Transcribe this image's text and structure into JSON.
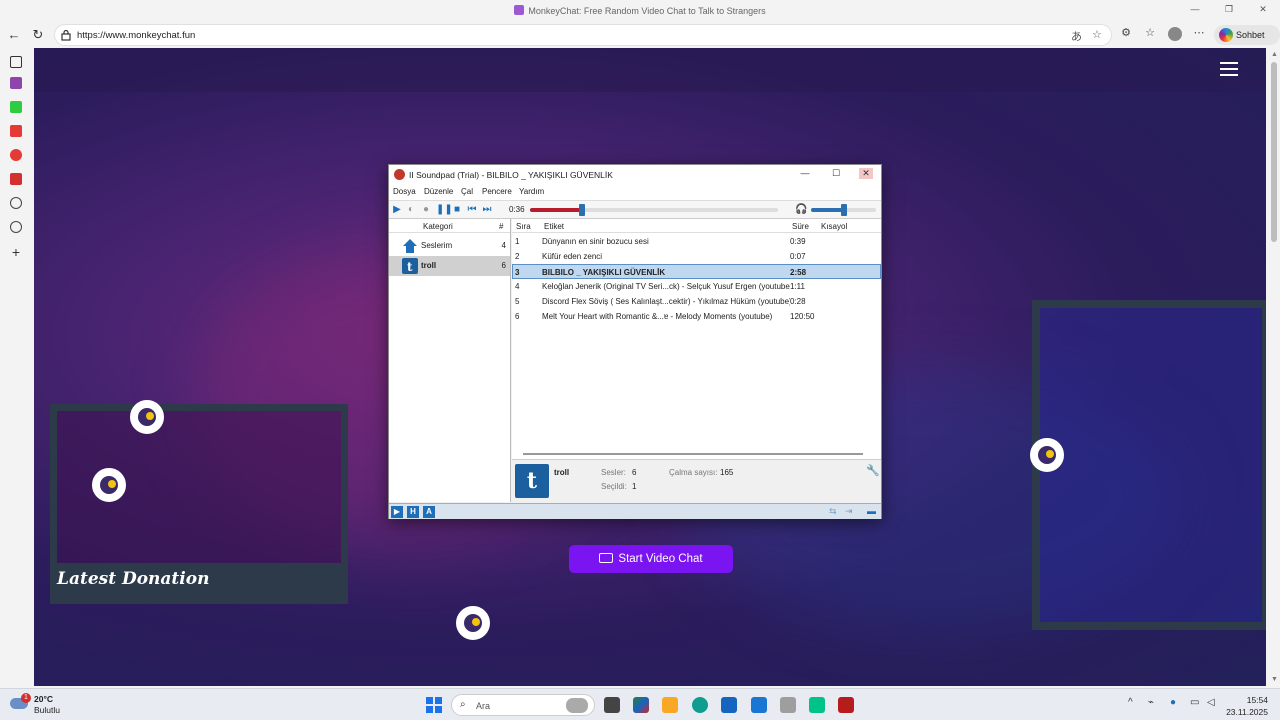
{
  "browser": {
    "window_title": "MonkeyChat: Free Random Video Chat to Talk to Strangers",
    "url": "https://www.monkeychat.fun",
    "copilot_label": "Sohbet et"
  },
  "page": {
    "latest_donation": "Latest Donation",
    "start_button": "Start Video Chat"
  },
  "soundpad": {
    "title": "II  Soundpad (Trial) - BILBILO _ YAKIŞIKLI GÜVENLİK",
    "menu": [
      "Dosya",
      "Düzenle",
      "Çal",
      "Pencere",
      "Yardım"
    ],
    "elapsed": "0:36",
    "progress_fraction": 0.21,
    "volume_fraction": 0.5,
    "categories_header": "Kategori",
    "count_header": "#",
    "categories": [
      {
        "name": "Seslerim",
        "count": "4",
        "icon": "home-icon"
      },
      {
        "name": "troll",
        "count": "6",
        "icon": "tumblr-icon"
      }
    ],
    "list_headers": {
      "index": "Sıra",
      "label": "Etiket",
      "duration": "Süre",
      "shortcut": "Kısayol"
    },
    "sounds": [
      {
        "idx": "1",
        "label": "Dünyanın en sinir bozucu sesi",
        "dur": "0:39"
      },
      {
        "idx": "2",
        "label": "Küfür eden zenci",
        "dur": "0:07"
      },
      {
        "idx": "3",
        "label": "BILBILO _ YAKIŞIKLI GÜVENLİK",
        "dur": "2:58"
      },
      {
        "idx": "4",
        "label": "Keloğlan Jenerik (Original TV Seri...ck) - Selçuk Yusuf Ergen (youtube)",
        "dur": "1:11"
      },
      {
        "idx": "5",
        "label": "Discord Flex Söviş ( Ses Kalınlaşt...cektir) - Yıkılmaz Hüküm (youtube)",
        "dur": "0:28"
      },
      {
        "idx": "6",
        "label": "Melt Your Heart with Romantic &...ɐ - Melody Moments (youtube)",
        "dur": "120:50"
      }
    ],
    "info": {
      "name": "troll",
      "sounds_label": "Sesler:",
      "sounds_value": "6",
      "selected_label": "Seçildi:",
      "selected_value": "1",
      "plays_label": "Çalma sayısı:",
      "plays_value": "165"
    },
    "status_buttons": [
      "▶",
      "H",
      "A"
    ]
  },
  "taskbar": {
    "temp": "20°C",
    "weather": "Bulutlu",
    "weather_badge": "1",
    "search_placeholder": "Ara",
    "time": "15:54",
    "date": "23.11.2025"
  }
}
